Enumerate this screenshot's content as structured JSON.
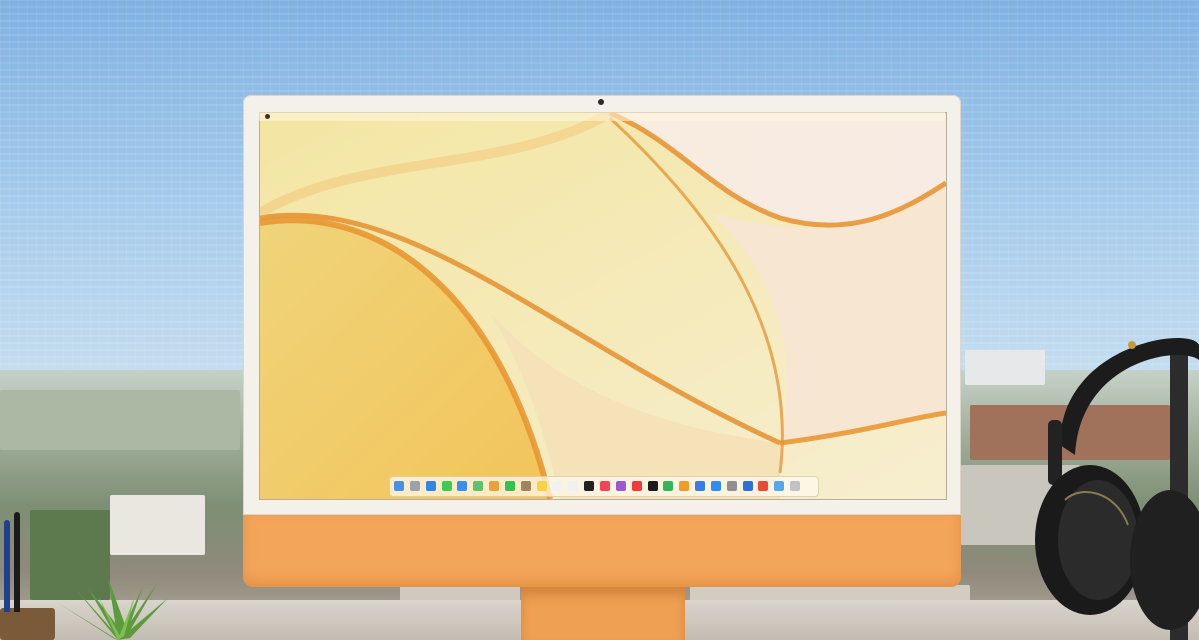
{
  "menubar": {
    "items": [
      "",
      "",
      "",
      "",
      "",
      "",
      ""
    ],
    "status_items": [
      "",
      "",
      "",
      "",
      "",
      ""
    ]
  },
  "dock": {
    "icons": [
      {
        "name": "finder-icon",
        "color": "#4a8fe8"
      },
      {
        "name": "launchpad-icon",
        "color": "#9aa2ad"
      },
      {
        "name": "safari-icon",
        "color": "#2f86e6"
      },
      {
        "name": "messages-icon",
        "color": "#3ecb55"
      },
      {
        "name": "mail-icon",
        "color": "#3a8ef0"
      },
      {
        "name": "maps-icon",
        "color": "#5cc36c"
      },
      {
        "name": "photos-icon",
        "color": "#e7a23c"
      },
      {
        "name": "facetime-icon",
        "color": "#33c24d"
      },
      {
        "name": "contacts-icon",
        "color": "#a08462"
      },
      {
        "name": "notes-icon",
        "color": "#f5d24a"
      },
      {
        "name": "reminders-icon",
        "color": "#f2f2f2"
      },
      {
        "name": "calendar-icon",
        "color": "#f0f0f0"
      },
      {
        "name": "appletv-icon",
        "color": "#222222"
      },
      {
        "name": "music-icon",
        "color": "#f2435a"
      },
      {
        "name": "podcasts-icon",
        "color": "#9b59d0"
      },
      {
        "name": "news-icon",
        "color": "#ef3b3b"
      },
      {
        "name": "stocks-icon",
        "color": "#1d1d1d"
      },
      {
        "name": "numbers-icon",
        "color": "#33b65a"
      },
      {
        "name": "pages-icon",
        "color": "#f39a2e"
      },
      {
        "name": "keynote-icon",
        "color": "#3a7ce6"
      },
      {
        "name": "appstore-icon",
        "color": "#2f8cf0"
      },
      {
        "name": "settings-icon",
        "color": "#8e8e93"
      },
      {
        "name": "xcode-icon",
        "color": "#2d6fd8"
      },
      {
        "name": "chrome-icon",
        "color": "#e64b3b"
      },
      {
        "name": "folder-icon",
        "color": "#57a6ee"
      },
      {
        "name": "trash-icon",
        "color": "#bfc3c8"
      }
    ]
  },
  "colors": {
    "imac_chin": "#f3a55a",
    "imac_frame": "#f4f1ea",
    "wallpaper_cream": "#f6e7b4",
    "wallpaper_orange": "#e8922b",
    "sky": "#9cc3e6"
  }
}
